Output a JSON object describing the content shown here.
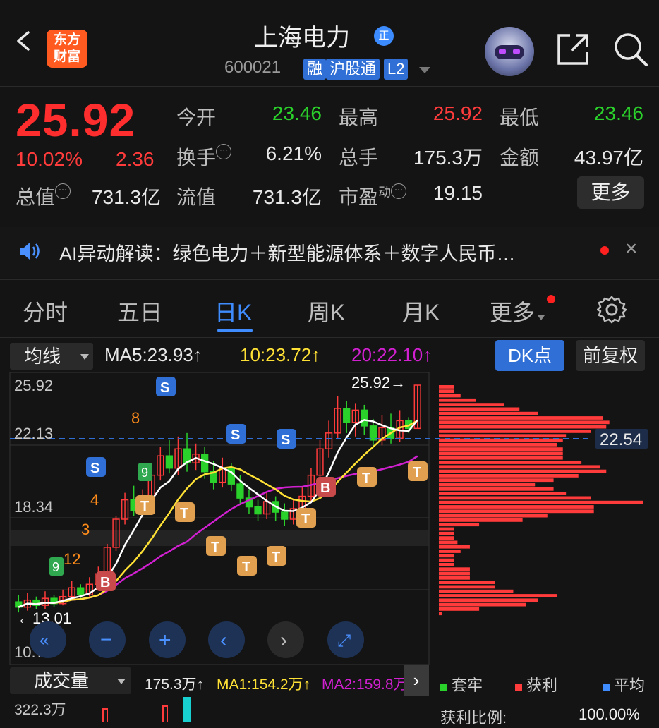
{
  "header": {
    "logo_line1": "东方",
    "logo_line2": "财富",
    "stock_name": "上海电力",
    "badge": "正",
    "stock_code": "600021",
    "tags": [
      "融",
      "沪股通",
      "L2"
    ]
  },
  "quote": {
    "price": "25.92",
    "change_pct": "10.02%",
    "change_amt": "2.36",
    "open_label": "今开",
    "open_value": "23.46",
    "high_label": "最高",
    "high_value": "25.92",
    "low_label": "最低",
    "low_value": "23.46",
    "turnover_label": "换手",
    "turnover_value": "6.21%",
    "volume_label": "总手",
    "volume_value": "175.3万",
    "amount_label": "金额",
    "amount_value": "43.97亿",
    "mktcap_label": "总值",
    "mktcap_value": "731.3亿",
    "float_label": "流值",
    "float_value": "731.3亿",
    "pe_label": "市盈",
    "pe_sup": "动",
    "pe_value": "19.15",
    "more_label": "更多"
  },
  "ai_bar": {
    "text": "AI异动解读：绿色电力＋新型能源体系＋数字人民币…",
    "close": "×"
  },
  "tabs": [
    "分时",
    "五日",
    "日K",
    "周K",
    "月K",
    "更多"
  ],
  "active_tab": "日K",
  "chart_toolbar": {
    "indicator_select": "均线",
    "ma5": "MA5:23.93↑",
    "ma10": "10:23.72↑",
    "ma20": "20:22.10↑",
    "dk_button": "DK点",
    "adjust_button": "前复权"
  },
  "colors": {
    "up": "#ff3b3b",
    "down": "#2bd12b",
    "ma5": "#ffffff",
    "ma10": "#ffe135",
    "ma20": "#d020d0",
    "accent": "#2f6fd6"
  },
  "chart_data": {
    "type": "candlestick",
    "y_ticks": [
      "25.92",
      "22.13",
      "18.34",
      "10.76"
    ],
    "ylim": [
      10.76,
      25.92
    ],
    "price_high_label": "25.92→",
    "price_low_label": "←13.01",
    "chip_avg_label": "22.54",
    "bars": [
      {
        "o": 13.6,
        "c": 13.3,
        "h": 14.0,
        "l": 13.0
      },
      {
        "o": 13.3,
        "c": 13.7,
        "h": 14.1,
        "l": 13.1
      },
      {
        "o": 13.7,
        "c": 13.4,
        "h": 13.9,
        "l": 13.2
      },
      {
        "o": 13.4,
        "c": 13.8,
        "h": 14.2,
        "l": 13.2
      },
      {
        "o": 13.8,
        "c": 13.5,
        "h": 14.0,
        "l": 13.3
      },
      {
        "o": 13.5,
        "c": 13.9,
        "h": 14.3,
        "l": 13.4
      },
      {
        "o": 13.9,
        "c": 14.4,
        "h": 14.8,
        "l": 13.7
      },
      {
        "o": 14.4,
        "c": 14.0,
        "h": 14.6,
        "l": 13.8
      },
      {
        "o": 14.0,
        "c": 14.6,
        "h": 15.0,
        "l": 13.9
      },
      {
        "o": 14.6,
        "c": 15.2,
        "h": 15.6,
        "l": 14.4
      },
      {
        "o": 15.2,
        "c": 16.7,
        "h": 16.9,
        "l": 15.0
      },
      {
        "o": 16.7,
        "c": 18.3,
        "h": 18.5,
        "l": 16.5
      },
      {
        "o": 18.3,
        "c": 19.4,
        "h": 19.8,
        "l": 18.0
      },
      {
        "o": 19.4,
        "c": 18.8,
        "h": 20.2,
        "l": 18.5
      },
      {
        "o": 18.8,
        "c": 19.6,
        "h": 20.0,
        "l": 18.6
      },
      {
        "o": 19.6,
        "c": 20.8,
        "h": 21.2,
        "l": 19.3
      },
      {
        "o": 20.8,
        "c": 21.9,
        "h": 22.4,
        "l": 20.5
      },
      {
        "o": 21.9,
        "c": 21.2,
        "h": 22.8,
        "l": 20.9
      },
      {
        "o": 21.2,
        "c": 22.3,
        "h": 23.0,
        "l": 20.8
      },
      {
        "o": 22.3,
        "c": 21.5,
        "h": 23.2,
        "l": 21.0
      },
      {
        "o": 21.5,
        "c": 22.0,
        "h": 22.6,
        "l": 21.1
      },
      {
        "o": 22.0,
        "c": 21.0,
        "h": 22.4,
        "l": 20.6
      },
      {
        "o": 21.0,
        "c": 20.4,
        "h": 21.6,
        "l": 20.0
      },
      {
        "o": 20.4,
        "c": 21.2,
        "h": 21.8,
        "l": 20.1
      },
      {
        "o": 21.2,
        "c": 20.3,
        "h": 21.5,
        "l": 19.9
      },
      {
        "o": 20.3,
        "c": 19.5,
        "h": 20.8,
        "l": 19.1
      },
      {
        "o": 19.5,
        "c": 19.0,
        "h": 20.0,
        "l": 18.6
      },
      {
        "o": 19.0,
        "c": 18.6,
        "h": 19.4,
        "l": 18.2
      },
      {
        "o": 18.6,
        "c": 19.3,
        "h": 19.8,
        "l": 18.3
      },
      {
        "o": 19.3,
        "c": 18.7,
        "h": 19.6,
        "l": 18.2
      },
      {
        "o": 18.7,
        "c": 18.3,
        "h": 19.2,
        "l": 17.9
      },
      {
        "o": 18.3,
        "c": 18.9,
        "h": 19.4,
        "l": 18.0
      },
      {
        "o": 18.9,
        "c": 19.6,
        "h": 20.1,
        "l": 18.6
      },
      {
        "o": 19.6,
        "c": 20.8,
        "h": 21.2,
        "l": 19.3
      },
      {
        "o": 20.8,
        "c": 22.3,
        "h": 22.8,
        "l": 20.5
      },
      {
        "o": 22.3,
        "c": 23.2,
        "h": 23.9,
        "l": 21.8
      },
      {
        "o": 23.2,
        "c": 24.6,
        "h": 25.3,
        "l": 22.9
      },
      {
        "o": 24.6,
        "c": 23.8,
        "h": 25.0,
        "l": 23.2
      },
      {
        "o": 23.8,
        "c": 24.5,
        "h": 24.9,
        "l": 23.0
      },
      {
        "o": 24.5,
        "c": 23.6,
        "h": 24.8,
        "l": 23.1
      },
      {
        "o": 23.6,
        "c": 22.8,
        "h": 24.0,
        "l": 22.4
      },
      {
        "o": 22.8,
        "c": 23.5,
        "h": 24.2,
        "l": 22.5
      },
      {
        "o": 23.5,
        "c": 22.9,
        "h": 24.3,
        "l": 22.6
      },
      {
        "o": 22.9,
        "c": 23.9,
        "h": 24.5,
        "l": 22.7
      },
      {
        "o": 23.9,
        "c": 23.46,
        "h": 24.1,
        "l": 23.2
      },
      {
        "o": 23.46,
        "c": 25.92,
        "h": 25.92,
        "l": 23.46
      }
    ]
  },
  "chart_buttons": [
    "«",
    "−",
    "+",
    "‹",
    "›",
    "⤢"
  ],
  "volume_panel": {
    "select": "成交量",
    "vol": "175.3万↑",
    "ma1": "MA1:154.2万↑",
    "ma2": "MA2:159.8万↑",
    "max_label": "322.3万"
  },
  "chip_legend": {
    "trapped": "套牢",
    "profit": "获利",
    "average": "平均",
    "profit_ratio_label": "获利比例:",
    "profit_ratio_value": "100.00%"
  }
}
